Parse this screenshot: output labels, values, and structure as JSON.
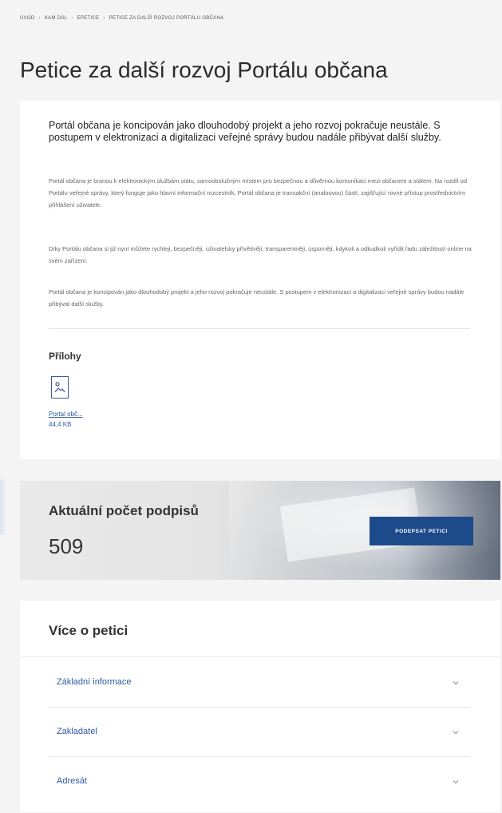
{
  "breadcrumb": [
    "Úvod",
    "Kam dál",
    "ePetice",
    "Petice za další rozvoj Portálu občana"
  ],
  "breadcrumb_sep": "›",
  "page_title": "Petice za další rozvoj Portálu občana",
  "main": {
    "lead": "Portál občana je koncipován jako dlouhodobý projekt a jeho rozvoj pokračuje neustále. S postupem v elektronizaci a digitalizaci veřejné správy budou nadále přibývat další služby.",
    "paragraphs": [
      "Portál občana je branou k elektronickým službám státu, samoobslužným místem pro bezpečnou a důvěrnou komunikaci mezi občanem a státem. Na rozdíl od Portálu veřejné správy, který funguje jako hlavní informační rozcestník, Portál občana je transakční (analoovou) částí, zajišťující rovné přístup prostřednictvím přihlášení uživatele.",
      "Díky Portálu občana si již nyní můžete rychleji, bezpečněji, uživatelsky přívětivěji, transparentněji, úsporněji, kdykoli a odkudkoli vyřídit řadu záležitostí online na svém zařízení.",
      "Portál občana je koncipován jako dlouhodobý projekt a jeho rozvoj pokračuje neustále. S postupem v elektronizaci a digitalizaci veřejné správy budou nadále přibývat další služby."
    ],
    "attachments_title": "Přílohy",
    "attachment": {
      "name": "Portal obč...",
      "size": "44,4 KB",
      "icon": "image-file-icon"
    }
  },
  "signatures": {
    "label": "Aktuální počet podpisů",
    "count": "509",
    "button_label": "Podepsat petici"
  },
  "more": {
    "title": "Více o petici",
    "items": [
      {
        "label": "Základní informace"
      },
      {
        "label": "Zakladatel"
      },
      {
        "label": "Adresát"
      }
    ]
  },
  "colors": {
    "accent": "#1d4a8b",
    "link": "#2d5aa0"
  }
}
